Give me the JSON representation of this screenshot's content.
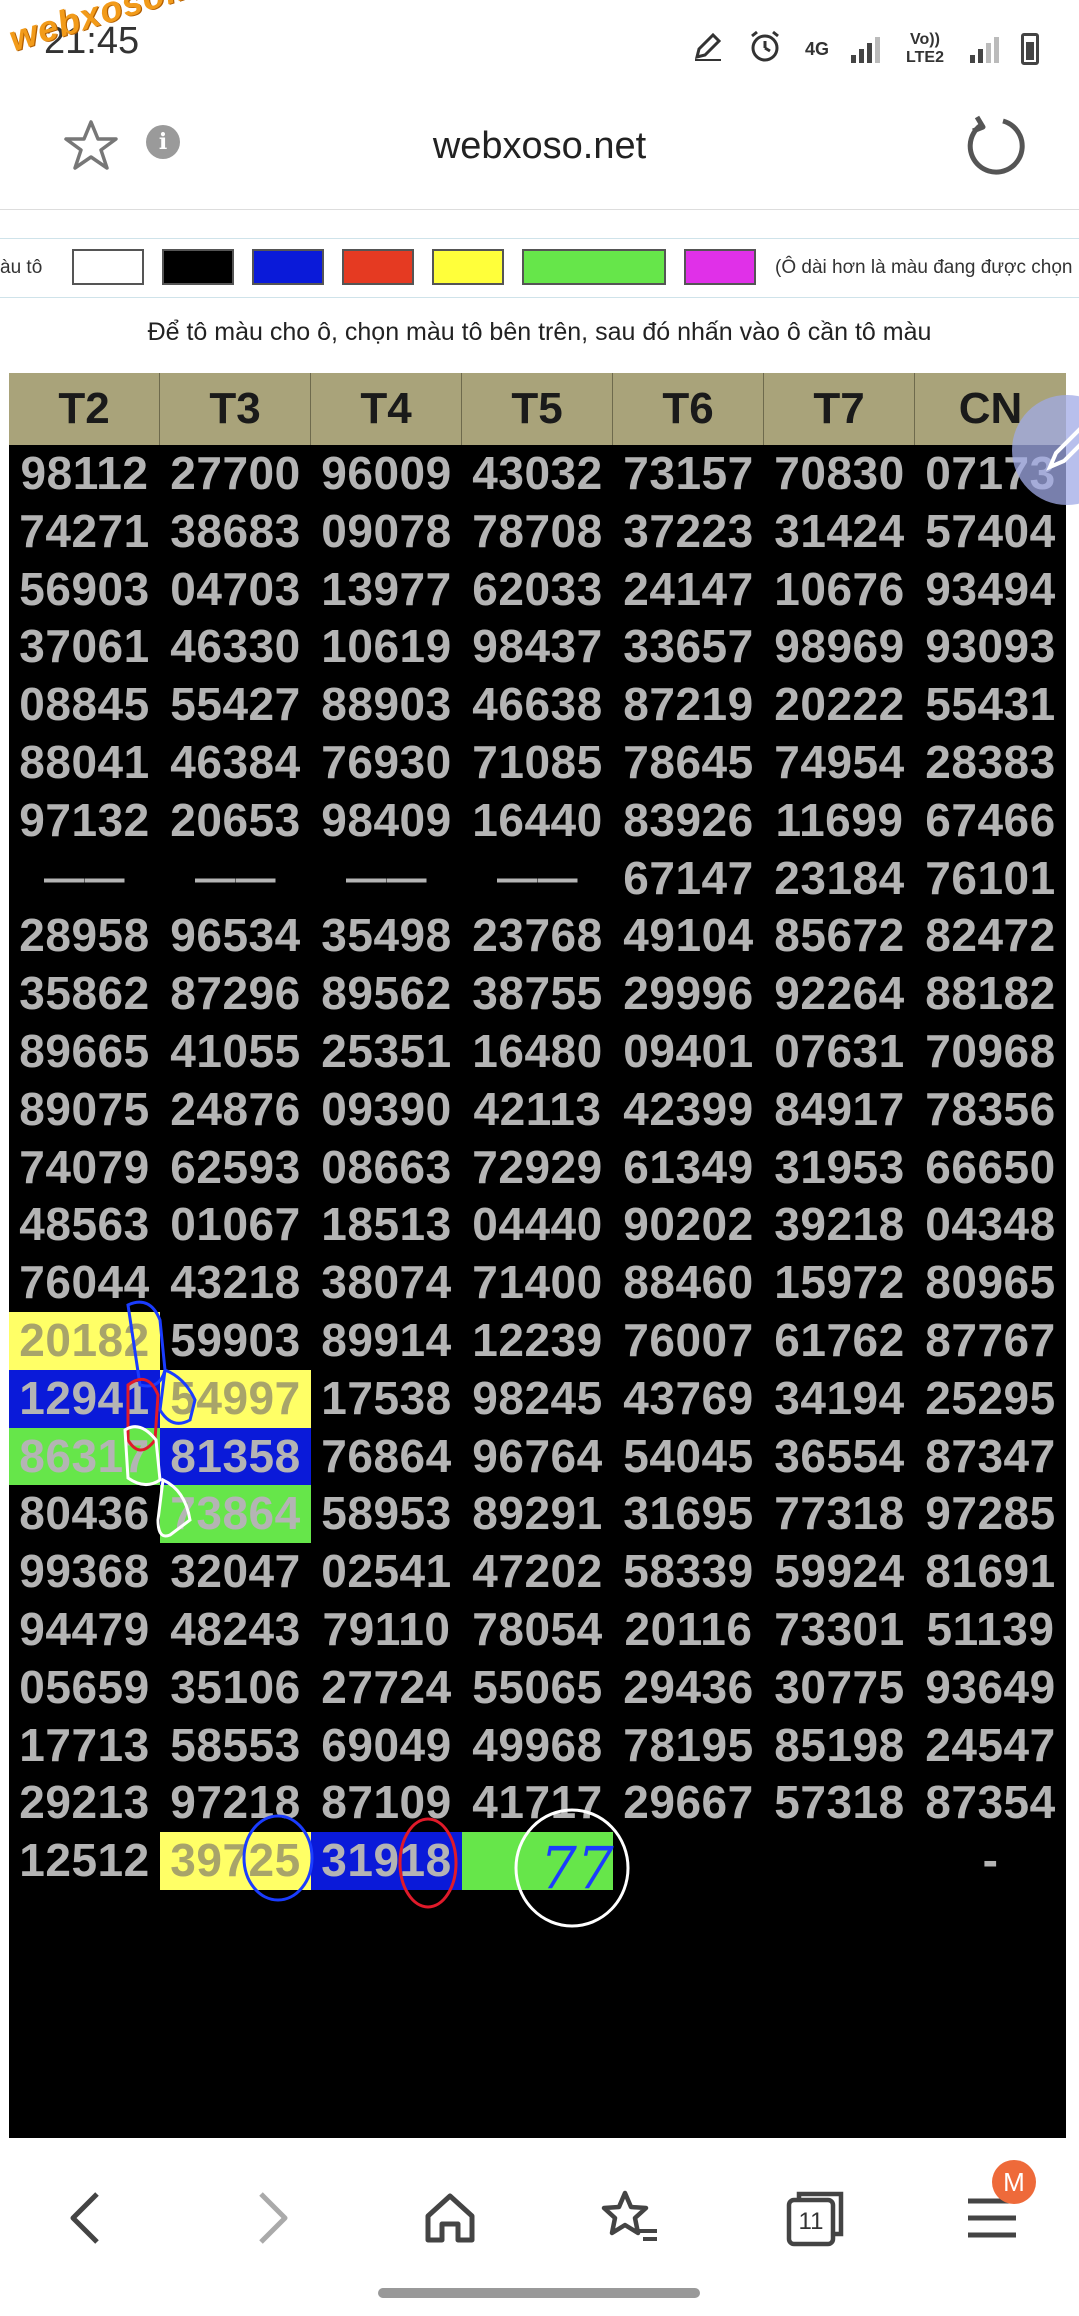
{
  "status": {
    "time": "21:45",
    "net_4g": "4G",
    "volte": "Vo)) LTE2"
  },
  "watermark": "webxoso.net",
  "browser": {
    "url": "webxoso.net",
    "tab_count": "11",
    "account_initial": "M"
  },
  "colors": {
    "white": "#ffffff",
    "black": "#000000",
    "blue": "#0a1ad9",
    "red": "#e53a22",
    "yellow": "#ffff3a",
    "green": "#66e64a",
    "magenta": "#e030e8"
  },
  "picker": {
    "label": "àu tô",
    "note": "(Ô dài hơn là màu đang được chọn"
  },
  "instruction": "Để tô màu cho ô, chọn màu tô bên trên, sau đó nhấn vào ô cần tô màu",
  "table": {
    "headers": [
      "T2",
      "T3",
      "T4",
      "T5",
      "T6",
      "T7",
      "CN"
    ],
    "rows": [
      [
        "98112",
        "27700",
        "96009",
        "43032",
        "73157",
        "70830",
        "07173"
      ],
      [
        "74271",
        "38683",
        "09078",
        "78708",
        "37223",
        "31424",
        "57404"
      ],
      [
        "56903",
        "04703",
        "13977",
        "62033",
        "24147",
        "10676",
        "93494"
      ],
      [
        "37061",
        "46330",
        "10619",
        "98437",
        "33657",
        "98969",
        "93093"
      ],
      [
        "08845",
        "55427",
        "88903",
        "46638",
        "87219",
        "20222",
        "55431"
      ],
      [
        "88041",
        "46384",
        "76930",
        "71085",
        "78645",
        "74954",
        "28383"
      ],
      [
        "97132",
        "20653",
        "98409",
        "16440",
        "83926",
        "11699",
        "67466"
      ],
      [
        "——",
        "——",
        "——",
        "——",
        "67147",
        "23184",
        "76101"
      ],
      [
        "28958",
        "96534",
        "35498",
        "23768",
        "49104",
        "85672",
        "82472"
      ],
      [
        "35862",
        "87296",
        "89562",
        "38755",
        "29996",
        "92264",
        "88182"
      ],
      [
        "89665",
        "41055",
        "25351",
        "16480",
        "09401",
        "07631",
        "70968"
      ],
      [
        "89075",
        "24876",
        "09390",
        "42113",
        "42399",
        "84917",
        "78356"
      ],
      [
        "74079",
        "62593",
        "08663",
        "72929",
        "61349",
        "31953",
        "66650"
      ],
      [
        "48563",
        "01067",
        "18513",
        "04440",
        "90202",
        "39218",
        "04348"
      ],
      [
        "76044",
        "43218",
        "38074",
        "71400",
        "88460",
        "15972",
        "80965"
      ],
      [
        "20182",
        "59903",
        "89914",
        "12239",
        "76007",
        "61762",
        "87767"
      ],
      [
        "12941",
        "54997",
        "17538",
        "98245",
        "43769",
        "34194",
        "25295"
      ],
      [
        "86317",
        "81358",
        "76864",
        "96764",
        "54045",
        "36554",
        "87347"
      ],
      [
        "80436",
        "73864",
        "58953",
        "89291",
        "31695",
        "77318",
        "97285"
      ],
      [
        "99368",
        "32047",
        "02541",
        "47202",
        "58339",
        "59924",
        "81691"
      ],
      [
        "94479",
        "48243",
        "79110",
        "78054",
        "20116",
        "73301",
        "51139"
      ],
      [
        "05659",
        "35106",
        "27724",
        "55065",
        "29436",
        "30775",
        "93649"
      ],
      [
        "17713",
        "58553",
        "69049",
        "49968",
        "78195",
        "85198",
        "24547"
      ],
      [
        "29213",
        "97218",
        "87109",
        "41717",
        "29667",
        "57318",
        "87354"
      ],
      [
        "12512",
        "39725",
        "31918",
        "",
        "",
        "",
        "-"
      ]
    ],
    "highlights": [
      {
        "row": 15,
        "col": 0,
        "color": "yellow"
      },
      {
        "row": 16,
        "col": 0,
        "color": "blue"
      },
      {
        "row": 16,
        "col": 1,
        "color": "yellow"
      },
      {
        "row": 17,
        "col": 0,
        "color": "green"
      },
      {
        "row": 17,
        "col": 1,
        "color": "blue"
      },
      {
        "row": 18,
        "col": 1,
        "color": "green"
      },
      {
        "row": 24,
        "col": 1,
        "color": "yellow"
      },
      {
        "row": 24,
        "col": 2,
        "color": "blue"
      },
      {
        "row": 24,
        "col": 3,
        "color": "green"
      }
    ],
    "handwritten_note": "77"
  }
}
